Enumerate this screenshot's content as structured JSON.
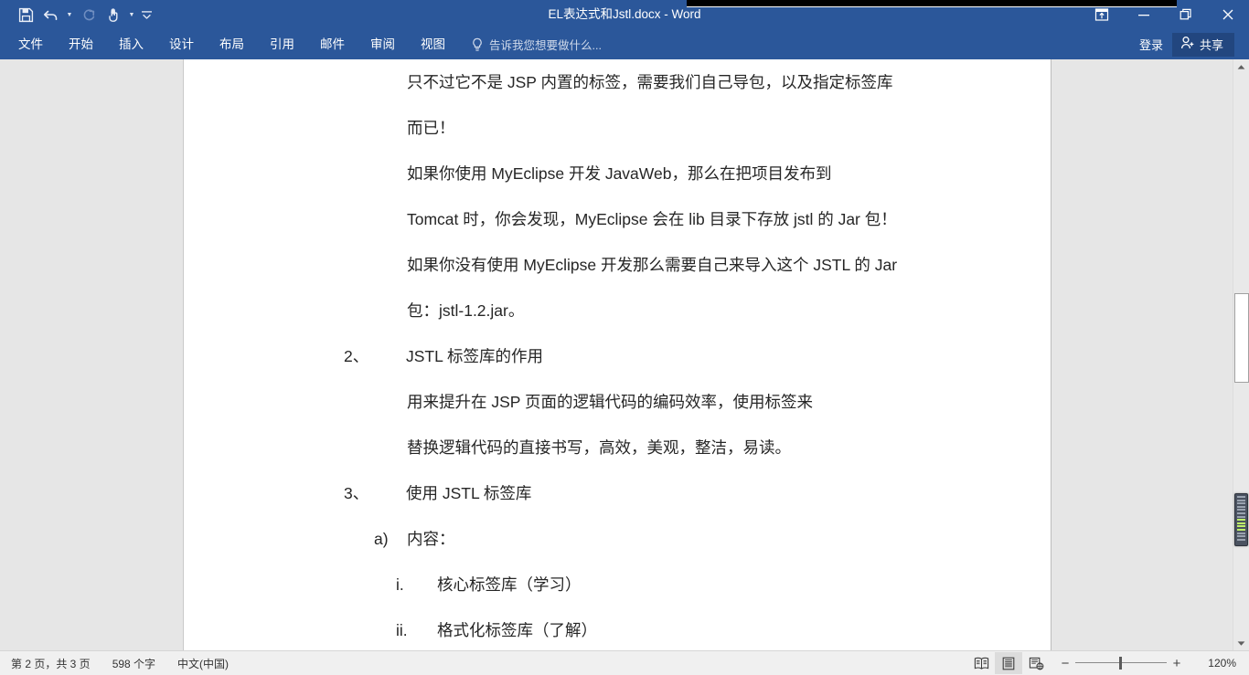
{
  "window": {
    "title": "EL表达式和Jstl.docx - Word",
    "controls": {
      "ribbon_display_options": "ribbon-display-options-icon",
      "minimize": "minimize-icon",
      "restore": "restore-icon",
      "close": "close-icon"
    }
  },
  "quick_access": {
    "save": "save-icon",
    "undo": "undo-icon",
    "redo": "redo-icon",
    "touch_mouse_mode": "touch-mode-icon",
    "customize": "customize-qat-icon"
  },
  "ribbon": {
    "tabs": [
      {
        "label": "文件"
      },
      {
        "label": "开始"
      },
      {
        "label": "插入"
      },
      {
        "label": "设计"
      },
      {
        "label": "布局"
      },
      {
        "label": "引用"
      },
      {
        "label": "邮件"
      },
      {
        "label": "审阅"
      },
      {
        "label": "视图"
      }
    ],
    "tell_me": "告诉我您想要做什么...",
    "sign_in": "登录",
    "share": "共享"
  },
  "document": {
    "paragraphs": [
      {
        "type": "body",
        "indent": 244,
        "text": "只不过它不是 JSP 内置的标签，需要我们自己导包，以及指定标签库"
      },
      {
        "type": "body",
        "indent": 244,
        "text": "而已！"
      },
      {
        "type": "body",
        "indent": 244,
        "text": "        如果你使用 MyEclipse 开发 JavaWeb，那么在把项目发布到"
      },
      {
        "type": "body",
        "indent": 244,
        "text": "Tomcat 时，你会发现，MyEclipse 会在 lib 目录下存放 jstl 的 Jar 包！"
      },
      {
        "type": "body",
        "indent": 244,
        "text": "如果你没有使用 MyEclipse 开发那么需要自己来导入这个 JSTL 的 Jar"
      },
      {
        "type": "body",
        "indent": 244,
        "text": "包：jstl-1.2.jar。"
      },
      {
        "type": "list1",
        "indent": 175,
        "marker": "2、",
        "marker_width": 68,
        "text": "JSTL 标签库的作用"
      },
      {
        "type": "body",
        "indent": 244,
        "text": "用来提升在 JSP 页面的逻辑代码的编码效率，使用标签来"
      },
      {
        "type": "body",
        "indent": 244,
        "text": "替换逻辑代码的直接书写，高效，美观，整洁，易读。"
      },
      {
        "type": "list1",
        "indent": 175,
        "marker": "3、",
        "marker_width": 68,
        "text": "使用 JSTL 标签库"
      },
      {
        "type": "list2",
        "indent": 208,
        "marker": "a)",
        "marker_width": 36,
        "text": "内容："
      },
      {
        "type": "list3",
        "indent": 232,
        "marker": "i.",
        "marker_width": 45,
        "text": "核心标签库（学习）"
      },
      {
        "type": "list3",
        "indent": 232,
        "marker": "ii.",
        "marker_width": 45,
        "text": "格式化标签库（了解）"
      }
    ]
  },
  "status_bar": {
    "page_info": "第 2 页，共 3 页",
    "word_count": "598 个字",
    "language": "中文(中国)",
    "views": {
      "read_mode": "read-mode-icon",
      "print_layout": "print-layout-icon",
      "web_layout": "web-layout-icon"
    },
    "zoom_out": "−",
    "zoom_in": "+",
    "zoom_level": "120%"
  },
  "scrollbar": {
    "up_arrow": "scroll-up-icon",
    "down_arrow": "scroll-down-icon"
  },
  "colors": {
    "accent": "#2b579a",
    "share_bg": "#22467f",
    "page_bg": "#ffffff",
    "workspace_bg": "#e6e6e6",
    "status_bg": "#f0f0f0",
    "battery_fill": "#bff06a"
  }
}
